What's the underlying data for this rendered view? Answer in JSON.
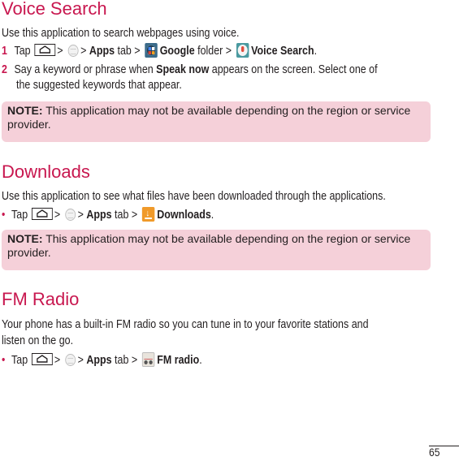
{
  "sections": {
    "voice_search": {
      "title": "Voice Search",
      "intro": "Use this application to search webpages using voice.",
      "step1": {
        "number": "1",
        "tap": "Tap",
        "sep1": ">",
        "sep2": "> ",
        "apps": "Apps",
        "tab": " tab > ",
        "google": "Google",
        "folder": " folder > ",
        "target": "Voice Search",
        "end": "."
      },
      "step2": {
        "number": "2",
        "text_a": "Say a keyword or phrase when ",
        "bold": "Speak now",
        "text_b": " appears on the screen. Select one of",
        "text_c": "the suggested keywords that appear."
      },
      "note": {
        "label": "NOTE:",
        "text": " This application may not be available depending on the region or service provider."
      }
    },
    "downloads": {
      "title": "Downloads",
      "intro": "Use this application to see what files have been downloaded through the applications.",
      "step": {
        "bullet": "•",
        "tap": "Tap",
        "sep1": ">",
        "sep2": "> ",
        "apps": "Apps",
        "tab": " tab > ",
        "target": "Downloads",
        "end": "."
      },
      "note": {
        "label": "NOTE:",
        "text": " This application may not be available depending on the region or service provider."
      }
    },
    "fm_radio": {
      "title": "FM Radio",
      "intro_a": "Your phone has a built-in FM radio so you can tune in to your favorite stations and",
      "intro_b": "listen on the go.",
      "step": {
        "bullet": "•",
        "tap": "Tap",
        "sep1": ">",
        "sep2": "> ",
        "apps": "Apps",
        "tab": " tab > ",
        "target": "FM radio",
        "end": "."
      }
    }
  },
  "icons": {
    "home_key": "home-key-icon",
    "apps": "apps-icon",
    "google_folder": "google-folder-icon",
    "voice_search": "microphone-icon",
    "downloads": "download-icon",
    "fm_radio": "radio-icon"
  },
  "colors": {
    "heading": "#c8174f",
    "note_bg": "#f5d0d9",
    "text": "#231f20"
  },
  "footer": {
    "page_number": "65"
  }
}
